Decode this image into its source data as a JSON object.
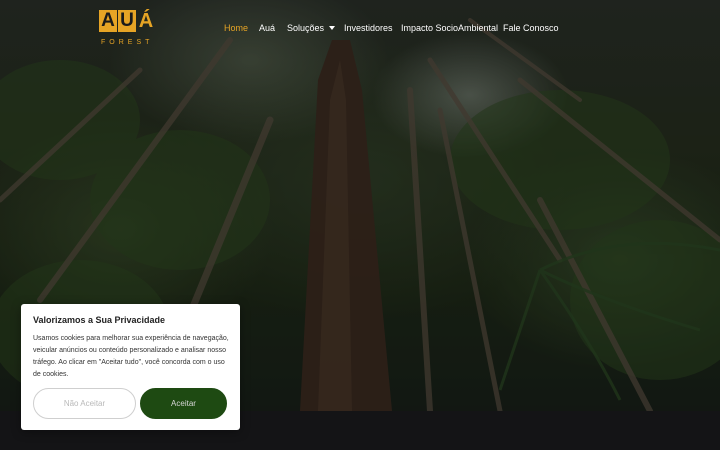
{
  "brand": {
    "logo_letters": [
      "A",
      "U",
      "Á"
    ],
    "logo_sub": "FOREST",
    "accent_color": "#e6a425"
  },
  "nav": {
    "items": [
      {
        "label": "Home",
        "active": true
      },
      {
        "label": "Auá",
        "active": false
      },
      {
        "label": "Soluções",
        "active": false,
        "dropdown": true
      },
      {
        "label": "Investidores",
        "active": false
      },
      {
        "label": "Impacto SocioAmbiental",
        "active": false
      },
      {
        "label": "Fale Conosco",
        "active": false
      }
    ]
  },
  "cookie": {
    "title": "Valorizamos a Sua Privacidade",
    "text": "Usamos cookies para melhorar sua experiência de navegação, veicular anúncios ou conteúdo personalizado e analisar nosso tráfego. Ao clicar em \"Aceitar tudo\", você concorda com o uso de cookies.",
    "reject_label": "Não Aceitar",
    "accept_label": "Aceitar",
    "accept_color": "#1e4a12"
  }
}
